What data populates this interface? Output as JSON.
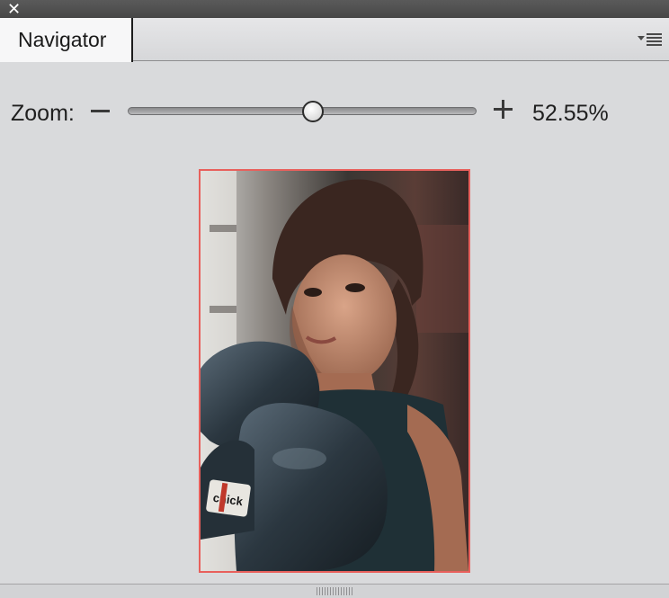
{
  "window": {
    "close_icon": "close-icon"
  },
  "panel": {
    "tab_label": "Navigator",
    "menu_icon": "panel-menu-icon"
  },
  "zoom": {
    "label": "Zoom:",
    "value_text": "52.55%",
    "slider_fraction": 0.53,
    "zoom_out_icon": "minus-icon",
    "zoom_in_icon": "plus-icon"
  },
  "preview": {
    "viewport_color": "#e8605c",
    "image_icon": "photo-thumbnail"
  }
}
